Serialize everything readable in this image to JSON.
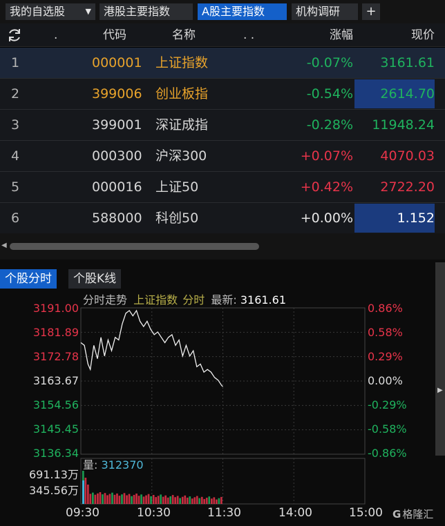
{
  "tabs": [
    {
      "label": "我的自选股",
      "active": false
    },
    {
      "label": "港股主要指数",
      "active": false
    },
    {
      "label": "A股主要指数",
      "active": true
    },
    {
      "label": "机构调研",
      "active": false
    }
  ],
  "dropdown_icon": "chevron-down-icon",
  "add_tab_label": "+",
  "columns": {
    "dot": ".",
    "code": "代码",
    "name": "名称",
    "dots": ". .",
    "change": "涨幅",
    "price": "现价"
  },
  "colors": {
    "up": "#e8344a",
    "down": "#1fb35e",
    "code_highlight": "#e8a32b",
    "active_tab": "#1460c9"
  },
  "rows": [
    {
      "idx": "1",
      "code": "000001",
      "name": "上证指数",
      "change": "-0.07%",
      "price": "3161.61"
    },
    {
      "idx": "2",
      "code": "399006",
      "name": "创业板指",
      "change": "-0.54%",
      "price": "2614.70"
    },
    {
      "idx": "3",
      "code": "399001",
      "name": "深证成指",
      "change": "-0.28%",
      "price": "11948.24"
    },
    {
      "idx": "4",
      "code": "000300",
      "name": "沪深300",
      "change": "+0.07%",
      "price": "4070.03"
    },
    {
      "idx": "5",
      "code": "000016",
      "name": "上证50",
      "change": "+0.42%",
      "price": "2722.20"
    },
    {
      "idx": "6",
      "code": "588000",
      "name": "科创50",
      "change": "+0.00%",
      "price": "1.152"
    }
  ],
  "subtabs": [
    {
      "label": "个股分时",
      "active": true
    },
    {
      "label": "个股K线",
      "active": false
    }
  ],
  "chart": {
    "caption_prefix": "分时走势",
    "stock_name": "上证指数",
    "mode": "分时",
    "latest_label": "最新:",
    "latest_value": "3161.61",
    "price_ticks": [
      "3191.00",
      "3181.89",
      "3172.78",
      "3163.67",
      "3154.56",
      "3145.45",
      "3136.34"
    ],
    "pct_ticks": [
      "0.86%",
      "0.58%",
      "0.29%",
      "0.00%",
      "-0.29%",
      "-0.58%",
      "-0.86%"
    ],
    "volume_label": "量:",
    "volume_value": "312370",
    "volume_ticks": [
      "691.13万",
      "345.56万"
    ],
    "time_ticks": [
      "09:30",
      "10:30",
      "11:30",
      "14:00",
      "15:00"
    ],
    "watermark": "格隆汇"
  },
  "chart_data": {
    "type": "line",
    "title": "分时走势 上证指数 分时",
    "x_range": [
      "09:30",
      "15:00"
    ],
    "ylim": [
      3136.34,
      3191.0
    ],
    "series": [
      {
        "name": "上证指数",
        "points": [
          [
            "09:30",
            3178
          ],
          [
            "09:33",
            3177
          ],
          [
            "09:36",
            3170
          ],
          [
            "09:38",
            3168
          ],
          [
            "09:41",
            3177
          ],
          [
            "09:44",
            3172
          ],
          [
            "09:47",
            3180
          ],
          [
            "09:50",
            3173
          ],
          [
            "09:53",
            3179
          ],
          [
            "09:56",
            3175
          ],
          [
            "09:59",
            3180
          ],
          [
            "10:02",
            3179
          ],
          [
            "10:05",
            3185
          ],
          [
            "10:08",
            3189
          ],
          [
            "10:11",
            3190
          ],
          [
            "10:14",
            3188
          ],
          [
            "10:17",
            3190
          ],
          [
            "10:20",
            3186
          ],
          [
            "10:23",
            3184
          ],
          [
            "10:26",
            3186
          ],
          [
            "10:29",
            3183
          ],
          [
            "10:32",
            3181
          ],
          [
            "10:35",
            3182
          ],
          [
            "10:38",
            3180
          ],
          [
            "10:41",
            3178
          ],
          [
            "10:44",
            3180
          ],
          [
            "10:47",
            3181
          ],
          [
            "10:50",
            3177
          ],
          [
            "10:53",
            3179
          ],
          [
            "10:56",
            3173
          ],
          [
            "10:59",
            3177
          ],
          [
            "11:02",
            3173
          ],
          [
            "11:05",
            3175
          ],
          [
            "11:08",
            3169
          ],
          [
            "11:11",
            3170
          ],
          [
            "11:14",
            3167
          ],
          [
            "11:17",
            3168
          ],
          [
            "11:20",
            3167
          ],
          [
            "11:23",
            3165
          ],
          [
            "11:26",
            3164
          ],
          [
            "11:29",
            3162
          ],
          [
            "11:30",
            3161.61
          ]
        ]
      }
    ]
  }
}
